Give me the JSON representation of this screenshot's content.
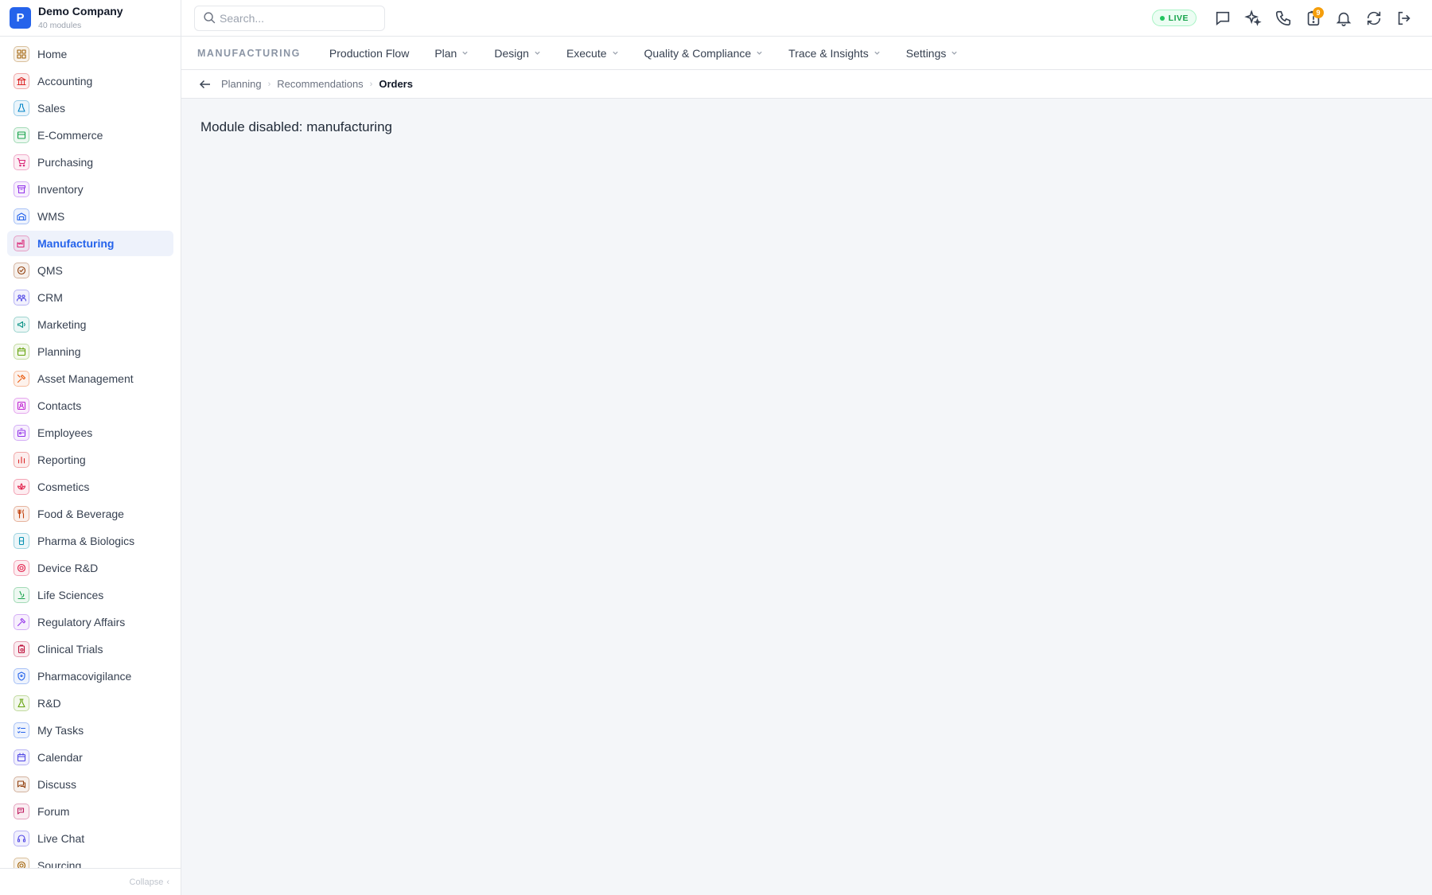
{
  "brand": {
    "logo_letter": "P",
    "name": "Demo Company",
    "subtitle": "40 modules"
  },
  "sidebar": {
    "items": [
      {
        "label": "Home",
        "icon": "grid-icon",
        "color": "#a16207"
      },
      {
        "label": "Accounting",
        "icon": "bank-icon",
        "color": "#dc2626"
      },
      {
        "label": "Sales",
        "icon": "flask-icon",
        "color": "#0284c7"
      },
      {
        "label": "E-Commerce",
        "icon": "store-icon",
        "color": "#16a34a"
      },
      {
        "label": "Purchasing",
        "icon": "cart-icon",
        "color": "#db2777"
      },
      {
        "label": "Inventory",
        "icon": "archive-icon",
        "color": "#9333ea"
      },
      {
        "label": "WMS",
        "icon": "warehouse-icon",
        "color": "#2563eb"
      },
      {
        "label": "Manufacturing",
        "icon": "factory-icon",
        "color": "#db2777",
        "active": true
      },
      {
        "label": "QMS",
        "icon": "check-badge-icon",
        "color": "#92400e"
      },
      {
        "label": "CRM",
        "icon": "users-icon",
        "color": "#4f46e5"
      },
      {
        "label": "Marketing",
        "icon": "megaphone-icon",
        "color": "#0d9488"
      },
      {
        "label": "Planning",
        "icon": "calendar-icon",
        "color": "#65a30d"
      },
      {
        "label": "Asset Management",
        "icon": "tools-icon",
        "color": "#ea580c"
      },
      {
        "label": "Contacts",
        "icon": "contact-icon",
        "color": "#c026d3"
      },
      {
        "label": "Employees",
        "icon": "badge-icon",
        "color": "#9333ea"
      },
      {
        "label": "Reporting",
        "icon": "bar-chart-icon",
        "color": "#dc2626"
      },
      {
        "label": "Cosmetics",
        "icon": "lotus-icon",
        "color": "#e11d48"
      },
      {
        "label": "Food & Beverage",
        "icon": "utensils-icon",
        "color": "#c2410c"
      },
      {
        "label": "Pharma & Biologics",
        "icon": "vial-icon",
        "color": "#0891b2"
      },
      {
        "label": "Device R&D",
        "icon": "cog-icon",
        "color": "#e11d48"
      },
      {
        "label": "Life Sciences",
        "icon": "microscope-icon",
        "color": "#16a34a"
      },
      {
        "label": "Regulatory Affairs",
        "icon": "gavel-icon",
        "color": "#9333ea"
      },
      {
        "label": "Clinical Trials",
        "icon": "clipboard-icon",
        "color": "#be123c"
      },
      {
        "label": "Pharmacovigilance",
        "icon": "shield-icon",
        "color": "#2563eb"
      },
      {
        "label": "R&D",
        "icon": "beaker-icon",
        "color": "#65a30d"
      },
      {
        "label": "My Tasks",
        "icon": "checklist-icon",
        "color": "#2563eb"
      },
      {
        "label": "Calendar",
        "icon": "calendar-icon",
        "color": "#4f46e5"
      },
      {
        "label": "Discuss",
        "icon": "chat-icon",
        "color": "#92400e"
      },
      {
        "label": "Forum",
        "icon": "forum-icon",
        "color": "#be185d"
      },
      {
        "label": "Live Chat",
        "icon": "headset-icon",
        "color": "#4f46e5"
      },
      {
        "label": "Sourcing",
        "icon": "target-icon",
        "color": "#a16207"
      }
    ],
    "collapse_label": "Collapse"
  },
  "topbar": {
    "search_placeholder": "Search...",
    "live_label": "LIVE",
    "notifications_count": "9",
    "icons": [
      "message-icon",
      "sparkles-icon",
      "phone-icon",
      "clipboard-alert-icon",
      "bell-icon",
      "refresh-icon",
      "logout-icon"
    ]
  },
  "module_nav": {
    "title": "MANUFACTURING",
    "items": [
      {
        "label": "Production Flow",
        "dropdown": false
      },
      {
        "label": "Plan",
        "dropdown": true
      },
      {
        "label": "Design",
        "dropdown": true
      },
      {
        "label": "Execute",
        "dropdown": true
      },
      {
        "label": "Quality & Compliance",
        "dropdown": true
      },
      {
        "label": "Trace & Insights",
        "dropdown": true
      },
      {
        "label": "Settings",
        "dropdown": true
      }
    ]
  },
  "breadcrumb": {
    "items": [
      "Planning",
      "Recommendations",
      "Orders"
    ]
  },
  "main": {
    "message": "Module disabled: manufacturing"
  }
}
